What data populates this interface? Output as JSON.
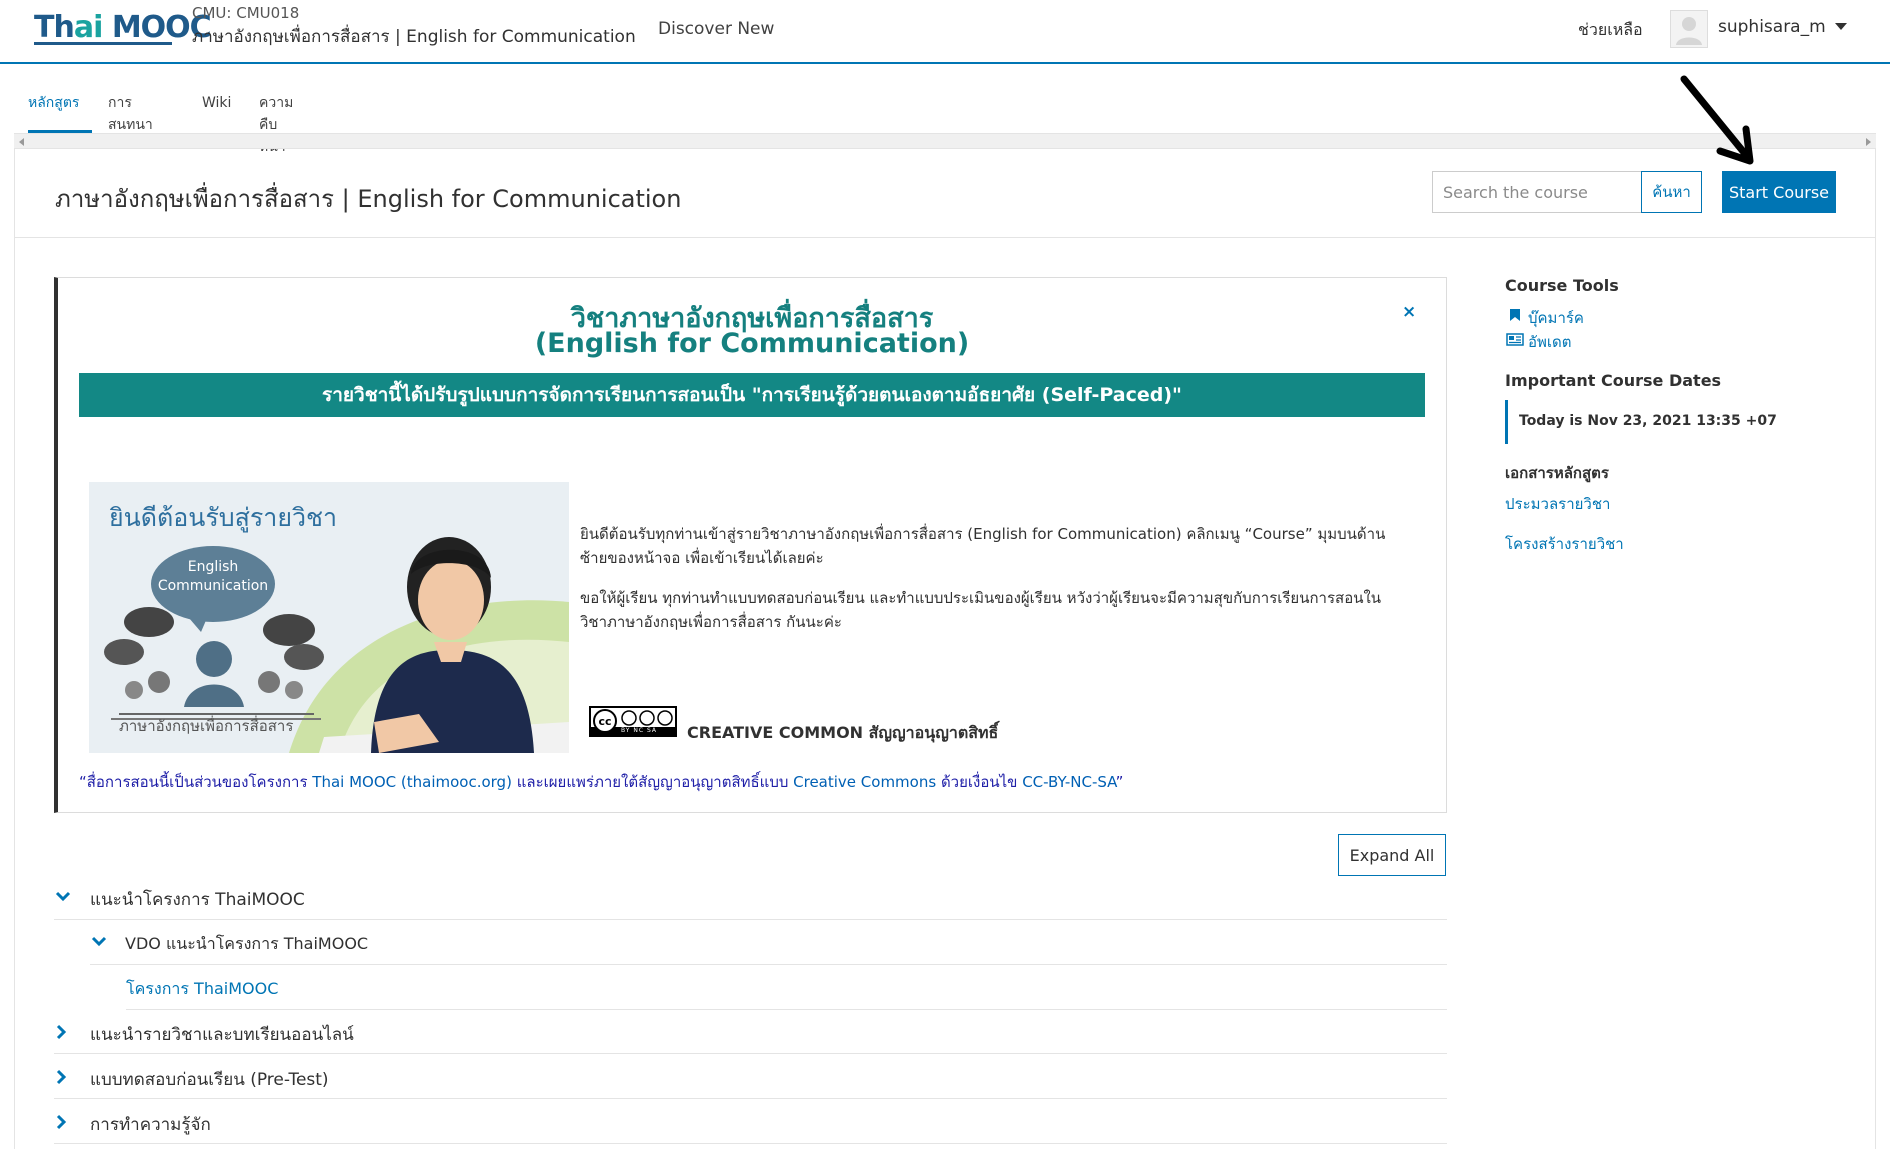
{
  "header": {
    "logo_text": "Thai MOOC",
    "course_org": "CMU: CMU018",
    "course_name": "ภาษาอังกฤษเพื่อการสื่อสาร | English for Communication",
    "discover": "Discover New",
    "help": "ช่วยเหลือ",
    "username": "suphisara_m"
  },
  "tabs": [
    {
      "label": "หลักสูตร",
      "active": true
    },
    {
      "label": "การสนทนา",
      "active": false
    },
    {
      "label": "Wiki",
      "active": false
    },
    {
      "label": "ความคืบหน้า",
      "active": false
    }
  ],
  "title_bar": {
    "page_title": "ภาษาอังกฤษเพื่อการสื่อสาร | English for Communication",
    "search_placeholder": "Search the course",
    "search_button": "ค้นหา",
    "start_button": "Start Course"
  },
  "welcome": {
    "title_line1": "วิชาภาษาอังกฤษเพื่อการสื่อสาร",
    "title_line2": "(English for Communication)",
    "close": "×",
    "banner": "รายวิชานี้ได้ปรับรูปแบบการจัดการเรียนการสอนเป็น \"การเรียนรู้ด้วยตนเองตามอัธยาศัย (Self-Paced)\"",
    "image_heading": "ยินดีต้อนรับสู่รายวิชา",
    "image_bubble_line1": "English",
    "image_bubble_line2": "Communication",
    "image_caption": "ภาษาอังกฤษเพื่อการสื่อสาร",
    "paragraph1": "ยินดีต้อนรับทุกท่านเข้าสู่รายวิชาภาษาอังกฤษเพื่อการสื่อสาร (English for Communication) คลิกเมนู “Course” มุมบนด้านซ้ายของหน้าจอ เพื่อเข้าเรียนได้เลยค่ะ",
    "paragraph2": "ขอให้ผู้เรียน ทุกท่านทำแบบทดสอบก่อนเรียน และทำแบบประเมินของผู้เรียน หวังว่าผู้เรียนจะมีความสุขกับการเรียนการสอนใน วิชาภาษาอังกฤษเพื่อการสื่อสาร กันนะค่ะ",
    "cc_badge": "BY NC SA",
    "cc_label": "CREATIVE COMMON สัญญาอนุญาตสิทธิ์",
    "license_part1": "“สื่อการสอนนี้เป็นส่วนของโครงการ ",
    "license_link1": "Thai MOOC (thaimooc.org)",
    "license_part2": " และเผยแพร่ภายใต้สัญญาอนุญาตสิทธิ์แบบ ",
    "license_link2": "Creative Commons",
    "license_part3": " ด้วยเงื่อนไข ",
    "license_link3": "CC-BY-NC-SA",
    "license_part4": "”"
  },
  "outline": {
    "expand_all": "Expand All",
    "sections": [
      {
        "label": "แนะนำโครงการ ThaiMOOC",
        "expanded": true
      },
      {
        "label": "VDO แนะนำโครงการ ThaiMOOC",
        "expanded": true
      },
      {
        "label": "โครงการ ThaiMOOC"
      },
      {
        "label": "แนะนำรายวิชาและบทเรียนออนไลน์",
        "expanded": false
      },
      {
        "label": "แบบทดสอบก่อนเรียน (Pre-Test)",
        "expanded": false
      },
      {
        "label": "การทำความรู้จัก",
        "expanded": false
      }
    ]
  },
  "sidebar": {
    "tools_heading": "Course Tools",
    "bookmark": "บุ๊คมาร์ค",
    "updates": "อัพเดต",
    "dates_heading": "Important Course Dates",
    "today": "Today is Nov 23, 2021 13:35 +07",
    "handouts_heading": "เอกสารหลักสูตร",
    "handout1": "ประมวลรายวิชา",
    "handout2": "โครงสร้างรายวิชา"
  },
  "colors": {
    "accent": "#0075b4",
    "teal": "#138885",
    "title_teal": "#15807f"
  }
}
